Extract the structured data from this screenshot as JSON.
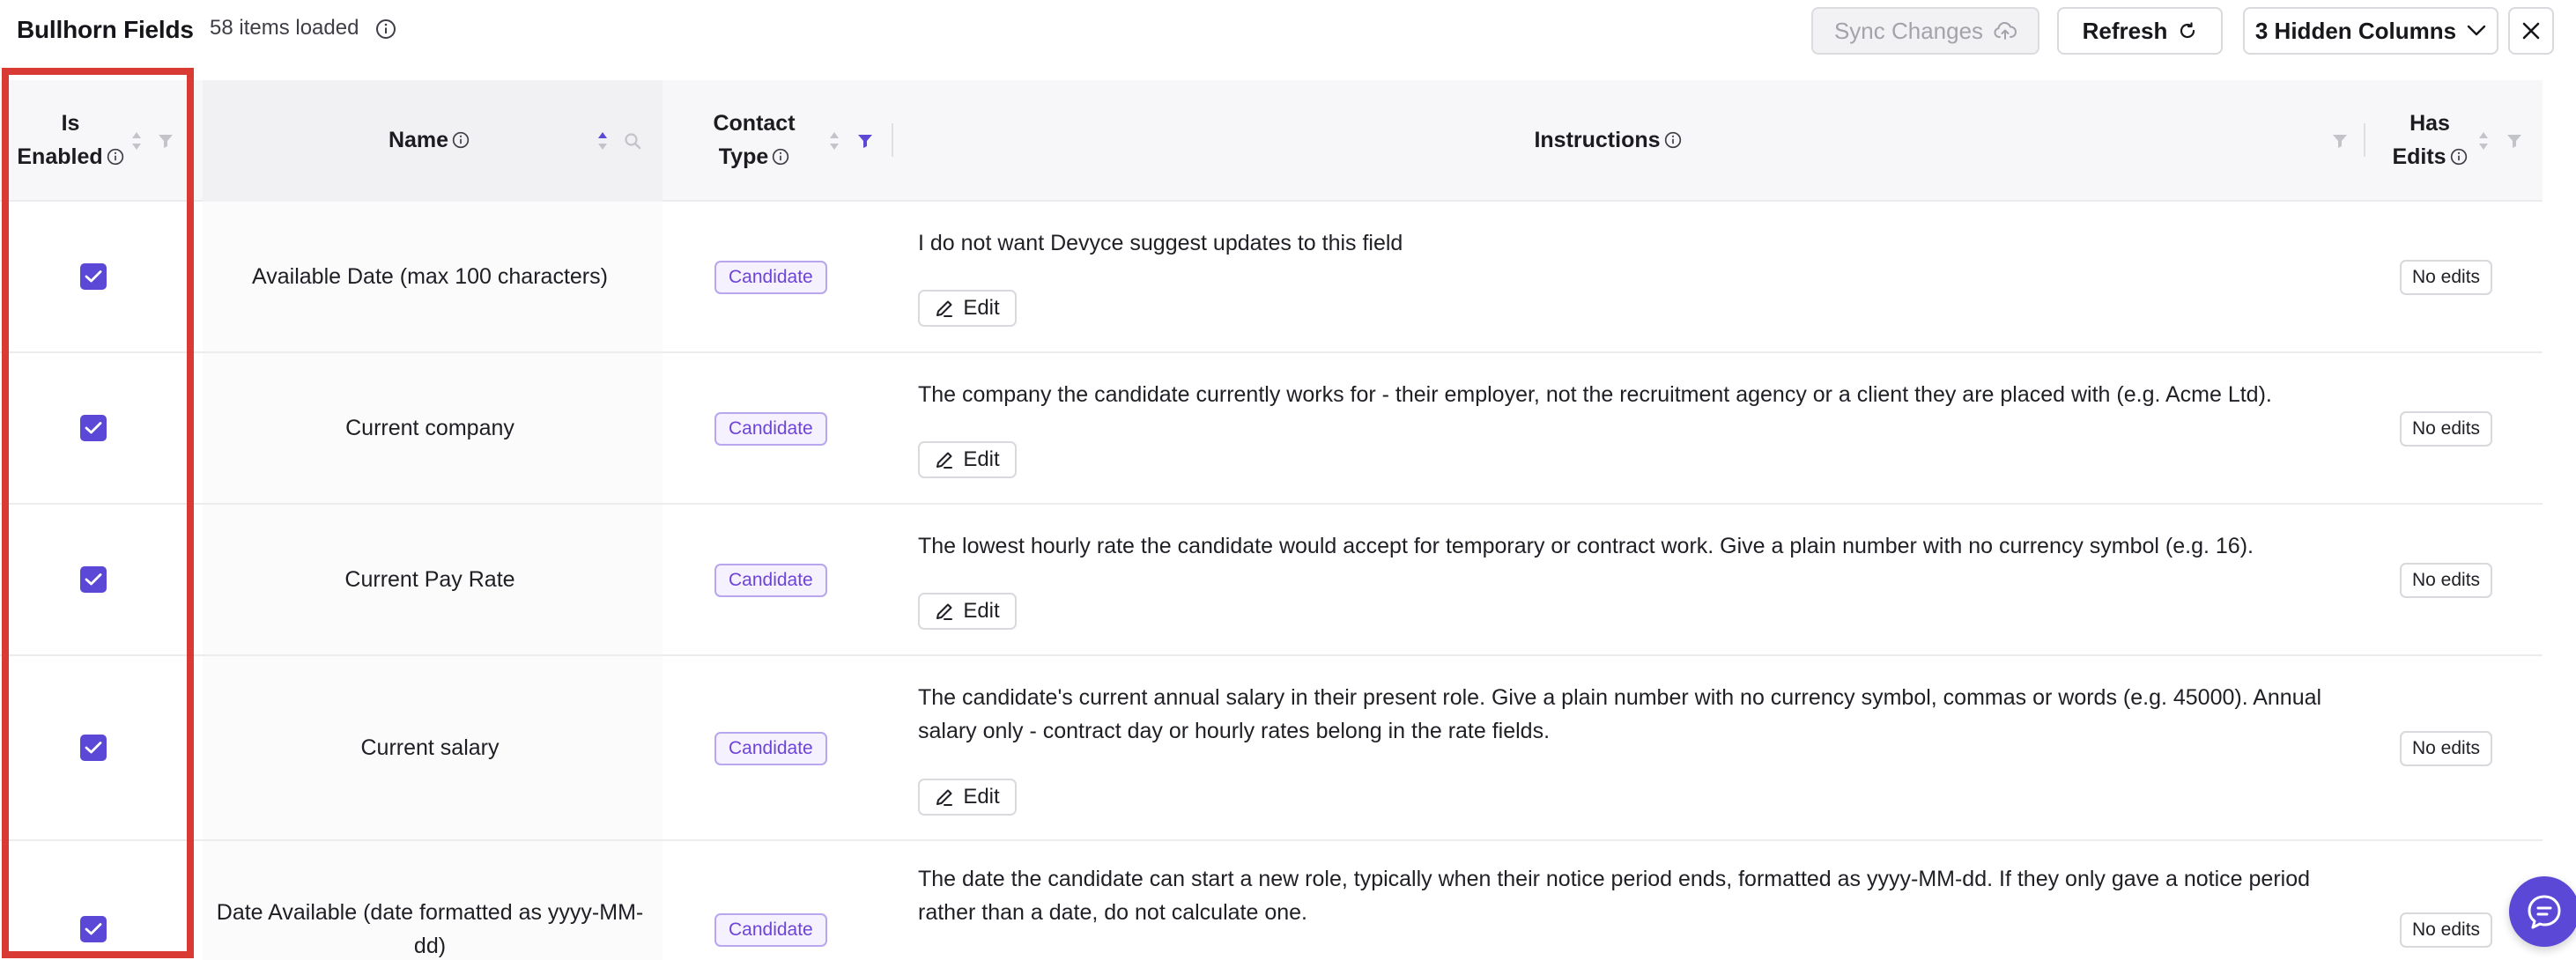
{
  "header": {
    "title": "Bullhorn Fields",
    "items_loaded": "58 items loaded",
    "sync_label": "Sync Changes",
    "refresh_label": "Refresh",
    "hidden_columns_label": "3 Hidden Columns"
  },
  "columns": {
    "is_enabled_line1": "Is",
    "is_enabled_line2": "Enabled",
    "name": "Name",
    "contact_type_line1": "Contact",
    "contact_type_line2": "Type",
    "instructions": "Instructions",
    "has_edits_line1": "Has",
    "has_edits_line2": "Edits"
  },
  "rows": [
    {
      "name": "Available Date (max 100 characters)",
      "contact_type": "Candidate",
      "instructions": "I do not want Devyce suggest updates to this field",
      "edit_label": "Edit",
      "has_edits": "No edits",
      "enabled": true
    },
    {
      "name": "Current company",
      "contact_type": "Candidate",
      "instructions": "The company the candidate currently works for - their employer, not the recruitment agency or a client they are placed with (e.g. Acme Ltd).",
      "edit_label": "Edit",
      "has_edits": "No edits",
      "enabled": true
    },
    {
      "name": "Current Pay Rate",
      "contact_type": "Candidate",
      "instructions": "The lowest hourly rate the candidate would accept for temporary or contract work. Give a plain number with no currency symbol (e.g. 16).",
      "edit_label": "Edit",
      "has_edits": "No edits",
      "enabled": true
    },
    {
      "name": "Current salary",
      "contact_type": "Candidate",
      "instructions": "The candidate's current annual salary in their present role. Give a plain number with no currency symbol, commas or words (e.g. 45000). Annual salary only - contract day or hourly rates belong in the rate fields.",
      "edit_label": "Edit",
      "has_edits": "No edits",
      "enabled": true
    },
    {
      "name": "Date Available (date formatted as yyyy-MM-dd)",
      "contact_type": "Candidate",
      "instructions": "The date the candidate can start a new role, typically when their notice period ends, formatted as yyyy-MM-dd. If they only gave a notice period rather than a date, do not calculate one.",
      "edit_label": "Edit",
      "has_edits": "No edits",
      "enabled": true
    }
  ],
  "colors": {
    "accent": "#5b48d6",
    "badge_text": "#6d43d8",
    "badge_border": "#b8a6ee",
    "highlight": "#d93a33"
  },
  "icons": [
    "info-icon",
    "cloud-upload-icon",
    "refresh-icon",
    "chevron-down-icon",
    "close-icon",
    "sort-icon",
    "filter-icon",
    "search-icon",
    "pencil-icon",
    "checkbox-checked-icon",
    "chat-icon"
  ]
}
